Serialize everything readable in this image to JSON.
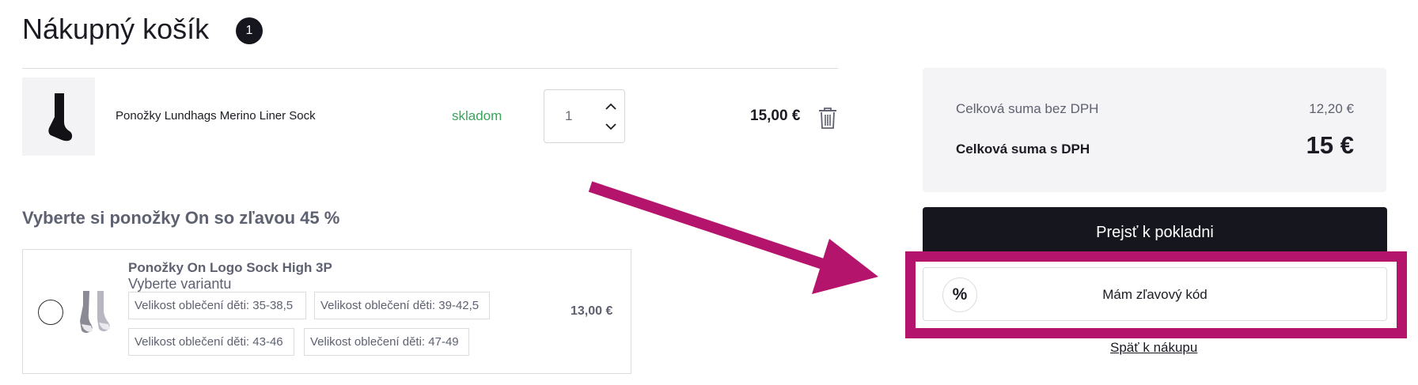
{
  "header": {
    "title": "Nákupný košík",
    "cart_count": "1"
  },
  "cart_item": {
    "name": "Ponožky Lundhags Merino Liner Sock",
    "stock": "skladom",
    "quantity": "1",
    "price": "15,00 €"
  },
  "upsell": {
    "heading": "Vyberte si ponožky On so zľavou 45 %",
    "product_name": "Ponožky On Logo Sock High 3P",
    "subtitle": "Vyberte variantu",
    "variants": [
      "Velikost oblečení děti: 35-38,5",
      "Velikost oblečení děti: 39-42,5",
      "Velikost oblečení děti: 43-46",
      "Velikost oblečení děti: 47-49"
    ],
    "price": "13,00 €"
  },
  "summary": {
    "net_label": "Celková suma bez DPH",
    "net_value": "12,20 €",
    "gross_label": "Celková suma s DPH",
    "gross_value": "15 €"
  },
  "actions": {
    "checkout_label": "Prejsť k pokladni",
    "discount_symbol": "%",
    "discount_label": "Mám zľavový kód",
    "back_label": "Späť k nákupu"
  },
  "colors": {
    "annotation": "#b5146c",
    "stock_green": "#3ba35c",
    "dark": "#16161f",
    "summary_bg": "#f4f4f6"
  }
}
